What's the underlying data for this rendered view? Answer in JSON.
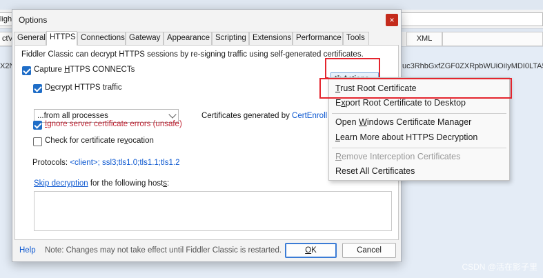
{
  "background": {
    "input_fragment": "ligh",
    "tab_fragment": "ctVie",
    "right_tab": "XML",
    "left_text_fragment": "X2N",
    "token_fragment": "uc3RhbGxfZGF0ZXRpbWUiOiIyMDI0LTA5LT",
    "watermark": "CSDN @活在影子里"
  },
  "dialog": {
    "title": "Options",
    "close_glyph": "×",
    "tabs": [
      "General",
      "HTTPS",
      "Connections",
      "Gateway",
      "Appearance",
      "Scripting",
      "Extensions",
      "Performance",
      "Tools"
    ],
    "active_tab": "HTTPS",
    "description": "Fiddler Classic can decrypt HTTPS sessions by re-signing traffic using self-generated certificates.",
    "capture": {
      "label_pre": "Capture ",
      "label_key": "H",
      "label_post": "TTPS CONNECTs",
      "checked": true
    },
    "decrypt": {
      "label_pre": "D",
      "label_key": "e",
      "label_post": "crypt HTTPS traffic",
      "checked": true
    },
    "process_select": "...from all processes",
    "cert_generated": {
      "prefix": "Certificates generated by ",
      "engine": "CertEnroll e"
    },
    "ignore_errors": {
      "label_pre": "",
      "label_key": "I",
      "label_post": "gnore server certificate errors (unsafe)",
      "checked": true
    },
    "revocation": {
      "label_pre": "Check for certificate re",
      "label_key": "v",
      "label_post": "ocation",
      "checked": false
    },
    "protocols": {
      "label": "Protocols: ",
      "value": "<client>; ssl3;tls1.0;tls1.1;tls1.2"
    },
    "skip": {
      "link": "Skip decryption",
      "text_pre": " for the following host",
      "text_key": "s",
      "text_post": ":"
    },
    "actions_button": {
      "label_pre": "",
      "label_key": "A",
      "label_post": "ctions"
    },
    "help": "Help",
    "note": "Note: Changes may not take effect until Fiddler Classic is restarted.",
    "ok": {
      "label_pre": "",
      "label_key": "O",
      "label_post": "K"
    },
    "cancel": "Cancel"
  },
  "menu": {
    "items": [
      {
        "pre": "",
        "key": "T",
        "post": "rust Root Certificate",
        "disabled": false
      },
      {
        "pre": "E",
        "key": "x",
        "post": "port Root Certificate to Desktop",
        "disabled": false
      },
      {
        "pre": "Open ",
        "key": "W",
        "post": "indows Certificate Manager",
        "disabled": false
      },
      {
        "pre": "",
        "key": "L",
        "post": "earn More about HTTPS Decryption",
        "disabled": false
      },
      {
        "pre": "",
        "key": "R",
        "post": "emove Interception Certificates",
        "disabled": true
      },
      {
        "pre": "Reset All Certificates",
        "key": "",
        "post": "",
        "disabled": false
      }
    ]
  },
  "colors": {
    "highlight_border": "#e4252e",
    "checkbox_checked": "#1f6dc7",
    "link": "#0b57d0",
    "warning_text": "#c01f2f"
  }
}
